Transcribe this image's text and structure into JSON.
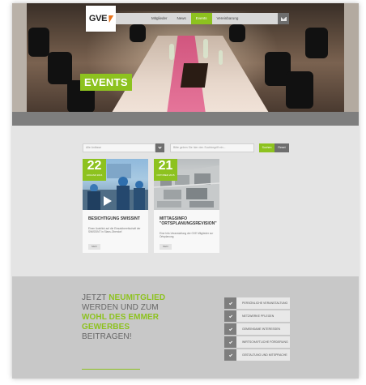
{
  "brand": {
    "logo_text": "GVE",
    "accent": "#8dc21f"
  },
  "nav": {
    "items": [
      {
        "label": "Mitglieder",
        "active": false
      },
      {
        "label": "News",
        "active": false
      },
      {
        "label": "Events",
        "active": true
      },
      {
        "label": "Vereinbarung",
        "active": false
      }
    ]
  },
  "hero": {
    "title": "EVENTS"
  },
  "filter": {
    "select_value": "Alle Anlässe",
    "search_placeholder": "Bitte geben Sie hier den Suchbegriff ein...",
    "search_button": "Suchen",
    "reset_button": "Reset"
  },
  "events": [
    {
      "day": "22",
      "month": "JANUAR 2016",
      "title": "BESICHTIGUNG SWISSINT",
      "desc": "Einen Ausblick auf die Einsatzbereitschaft der SWISSINT in Stans-Oberdorf.",
      "more": "Mehr"
    },
    {
      "day": "21",
      "month": "OKTOBER 2015",
      "title": "MITTAGSINFO \"ORTSPLANUNGSREVISION\"",
      "desc": "Eine Info-Veranstaltung der GVE Mitglieder zur Ortsplanung.",
      "more": "Mehr"
    }
  ],
  "join": {
    "l1_plain": "JETZT ",
    "l1_bold": "NEUMITGLIED",
    "l2": "WERDEN UND ZUM",
    "l3": "WOHL DES EMMER",
    "l4": "GEWERBES",
    "l5": "BEITRAGEN!"
  },
  "benefits": [
    "PERSÖNLICHE VERANSTALTUNG",
    "NETZWERKE PFLEGEN",
    "GEMEINSAME INTERESSEN",
    "WIRTSCHAFTLICHE FÖRDERUNG",
    "GESTALTUNG UND MITSPRACHE"
  ]
}
